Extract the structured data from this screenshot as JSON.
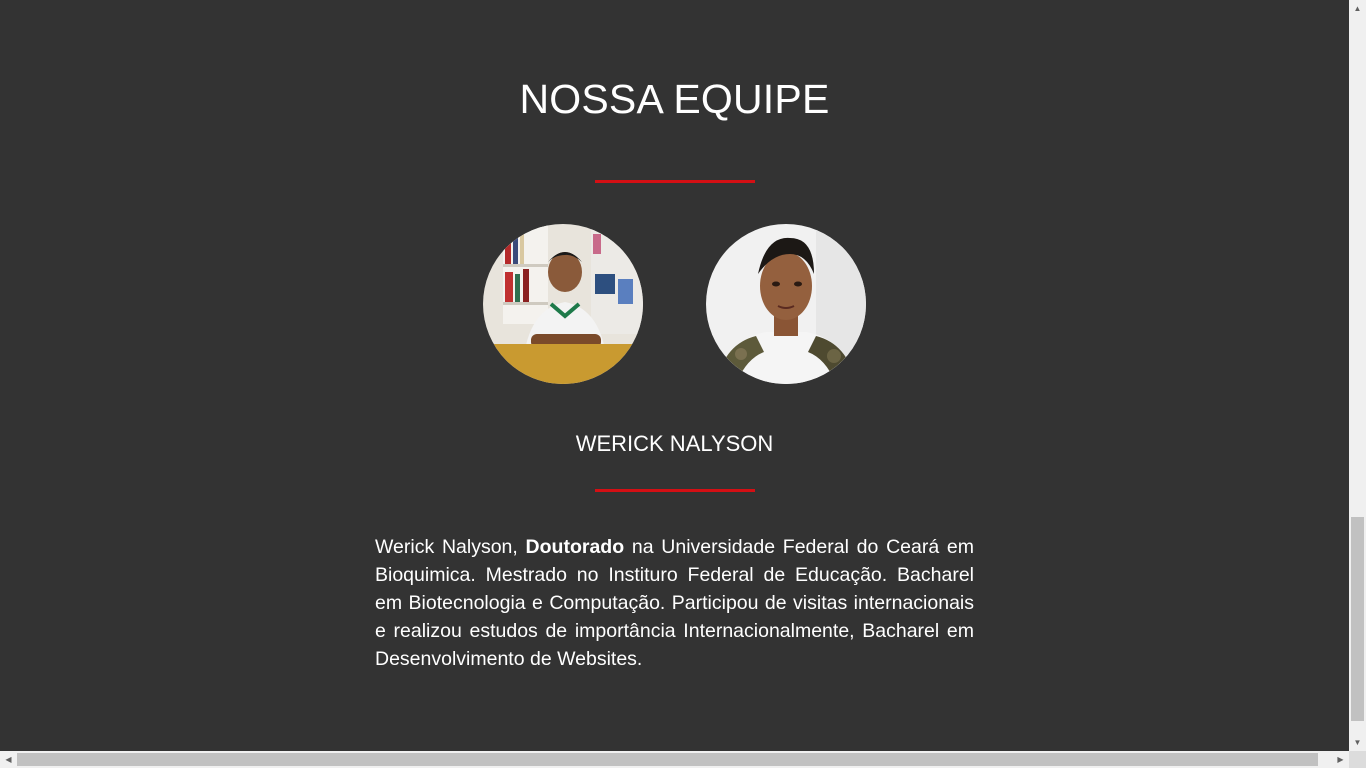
{
  "section": {
    "title": "NOSSA EQUIPE"
  },
  "team": {
    "members": [
      {
        "alt": "Foto do membro 1"
      },
      {
        "alt": "Foto do membro 2"
      }
    ],
    "active_name": "WERICK NALYSON",
    "bio": {
      "prefix": "Werick Nalyson, ",
      "highlight": "Doutorado",
      "text": " na Universidade Federal do Ceará em Bioquimica. Mestrado no Instituro Federal de Educação. Bacharel em Biotecnologia e Computação. Participou de visitas internacionais e realizou estudos de importância Internacionalmente, Bacharel em Desenvolvimento de Websites."
    }
  },
  "colors": {
    "background": "#333333",
    "accent": "#d40f14",
    "text": "#ffffff"
  },
  "scrollbars": {
    "up_icon": "▲",
    "down_icon": "▼",
    "left_icon": "◀",
    "right_icon": "▶"
  }
}
